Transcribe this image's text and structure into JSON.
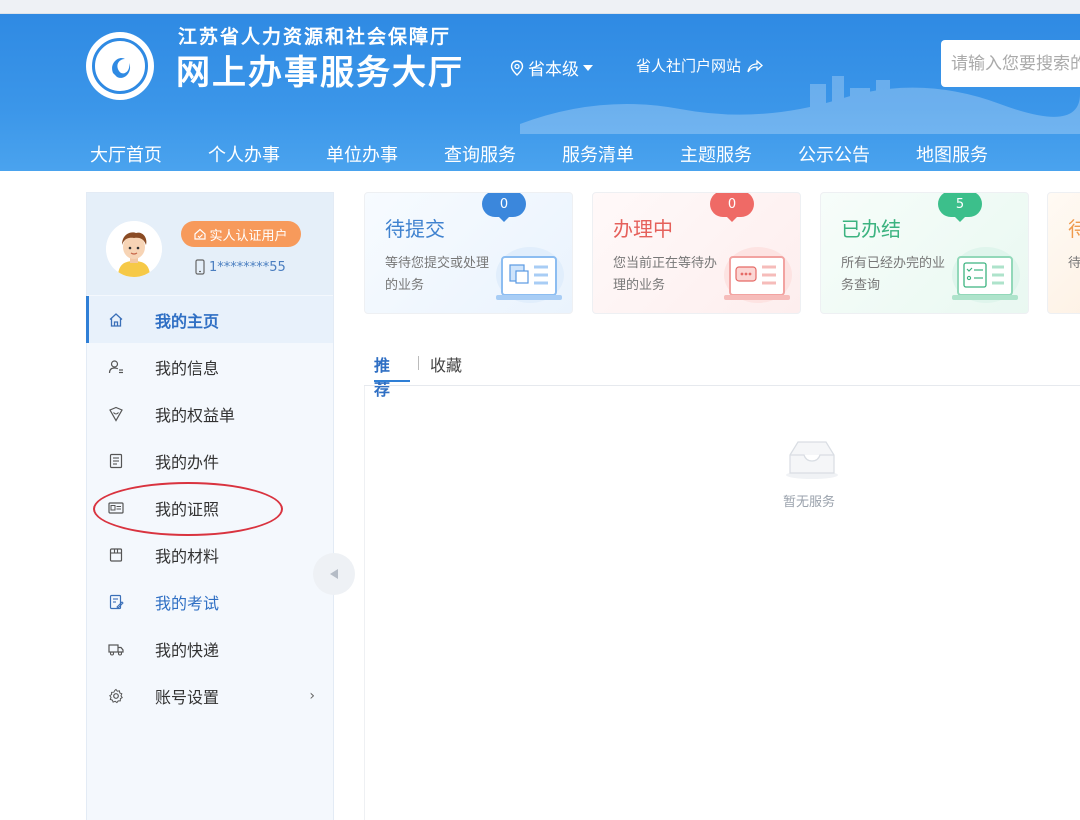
{
  "header": {
    "subtitle": "江苏省人力资源和社会保障厅",
    "title": "网上办事服务大厅",
    "level": "省本级",
    "portal_link": "省人社门户网站",
    "search_placeholder": "请输入您要搜索的"
  },
  "nav": {
    "items": [
      "大厅首页",
      "个人办事",
      "单位办事",
      "查询服务",
      "服务清单",
      "主题服务",
      "公示公告",
      "地图服务"
    ]
  },
  "profile": {
    "auth_badge": "实人认证用户",
    "phone": "1********55"
  },
  "sidebar": {
    "items": [
      {
        "label": "我的主页",
        "icon": "home-icon"
      },
      {
        "label": "我的信息",
        "icon": "user-info-icon"
      },
      {
        "label": "我的权益单",
        "icon": "heart-shield-icon"
      },
      {
        "label": "我的办件",
        "icon": "document-icon"
      },
      {
        "label": "我的证照",
        "icon": "id-card-icon"
      },
      {
        "label": "我的材料",
        "icon": "archive-icon"
      },
      {
        "label": "我的考试",
        "icon": "exam-icon"
      },
      {
        "label": "我的快递",
        "icon": "truck-icon"
      },
      {
        "label": "账号设置",
        "icon": "gear-icon"
      }
    ]
  },
  "cards": [
    {
      "title": "待提交",
      "desc": "等待您提交或处理的业务",
      "count": "0"
    },
    {
      "title": "办理中",
      "desc": "您当前正在等待办理的业务",
      "count": "0"
    },
    {
      "title": "已办结",
      "desc": "所有已经办完的业务查询",
      "count": "5"
    },
    {
      "title": "待",
      "desc": "待"
    }
  ],
  "tabs": {
    "recommend": "推荐",
    "favorites": "收藏"
  },
  "empty": {
    "text": "暂无服务"
  },
  "colors": {
    "header_blue": "#3b96e9",
    "accent_blue": "#2f7fd6",
    "badge_orange": "#f79a5b",
    "card_red": "#ef6a66",
    "card_green": "#3cbf8b",
    "annotation_red": "#d9333f"
  }
}
